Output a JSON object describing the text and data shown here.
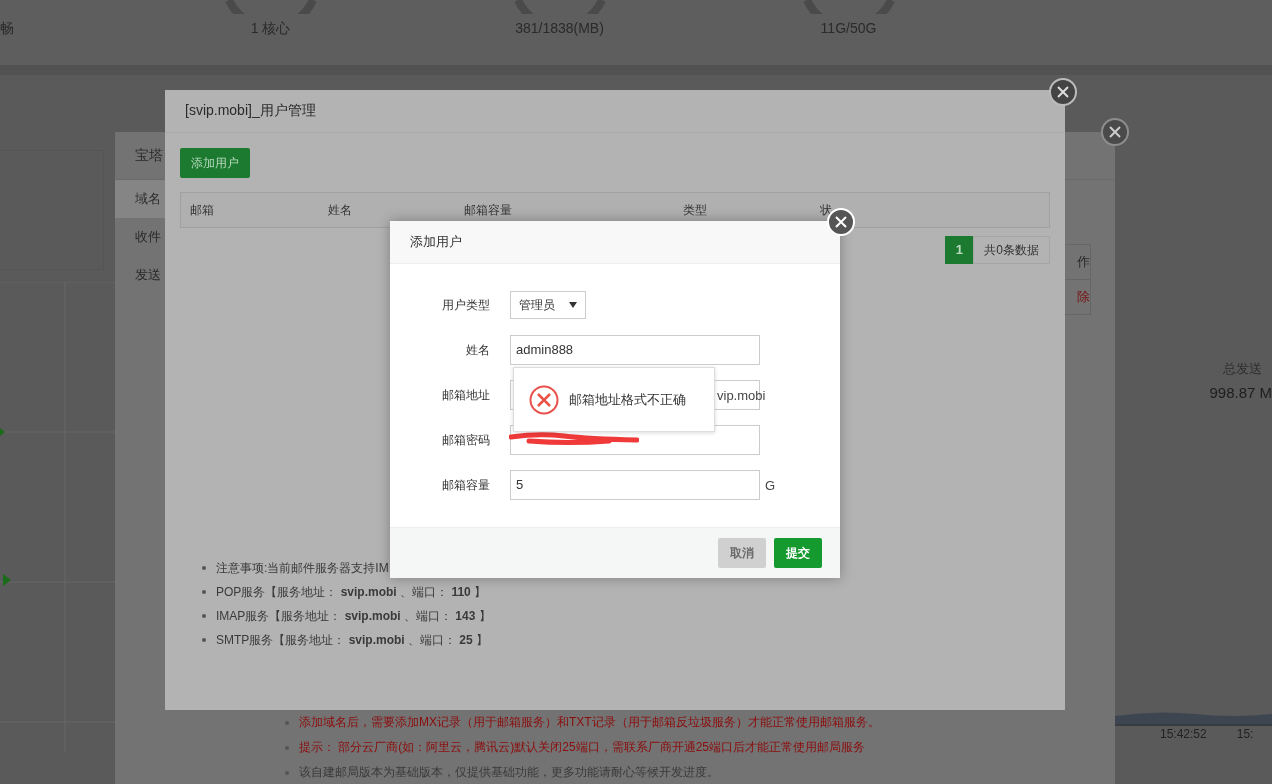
{
  "background_page": {
    "stats": [
      {
        "label": "畅"
      },
      {
        "label": "1 核心"
      },
      {
        "label": "381/1838(MB)"
      },
      {
        "label": "11G/50G"
      }
    ],
    "traffic": {
      "label": "总发送",
      "value": "998.87 M"
    },
    "time_labels": [
      "15:42:52",
      "15:"
    ]
  },
  "mail_window": {
    "title": "宝塔",
    "menu": [
      {
        "label": "域名",
        "selected": true
      },
      {
        "label": "收件",
        "selected": false
      },
      {
        "label": "发送",
        "selected": false
      }
    ],
    "table": {
      "header": "作",
      "row_action": "除"
    },
    "notes": [
      {
        "kind": "warning",
        "text": "添加域名后，需要添加MX记录（用于邮箱服务）和TXT记录（用于邮箱反垃圾服务）才能正常使用邮箱服务。"
      },
      {
        "kind": "warning",
        "text": "提示： 部分云厂商(如：阿里云，腾讯云)默认关闭25端口，需联系厂商开通25端口后才能正常使用邮局服务"
      },
      {
        "kind": "info",
        "text": "该自建邮局版本为基础版本，仅提供基础功能，更多功能请耐心等候开发进度。"
      }
    ]
  },
  "user_window": {
    "title": "[svip.mobi]_用户管理",
    "add_button": "添加用户",
    "columns": [
      "邮箱",
      "姓名",
      "邮箱容量",
      "类型",
      "状"
    ],
    "pagination": {
      "pages": [
        {
          "label": "1",
          "selected": true
        }
      ],
      "total": "共0条数据"
    },
    "notes": [
      "注意事项:当前邮件服务器支持IM",
      "POP服务【服务地址： **svip.mobi** 、端口： **110** 】",
      "IMAP服务【服务地址： **svip.mobi** 、端口： **143** 】",
      "SMTP服务【服务地址： **svip.mobi** 、端口： **25** 】"
    ]
  },
  "add_user_dialog": {
    "title": "添加用户",
    "fields": [
      {
        "kind": "select",
        "label": "用户类型",
        "value": "管理员"
      },
      {
        "kind": "text",
        "label": "姓名",
        "value": "admin888"
      },
      {
        "kind": "text",
        "label": "邮箱地址",
        "suffix": "vip.mobi"
      },
      {
        "kind": "redacted",
        "label": "邮箱密码"
      },
      {
        "kind": "text",
        "label": "邮箱容量",
        "value": "5",
        "unit": "G"
      }
    ],
    "buttons": [
      {
        "label": "取消",
        "disabled": true
      },
      {
        "label": "提交",
        "disabled": false
      }
    ]
  },
  "error_toast": {
    "message": "邮箱地址格式不正确"
  }
}
